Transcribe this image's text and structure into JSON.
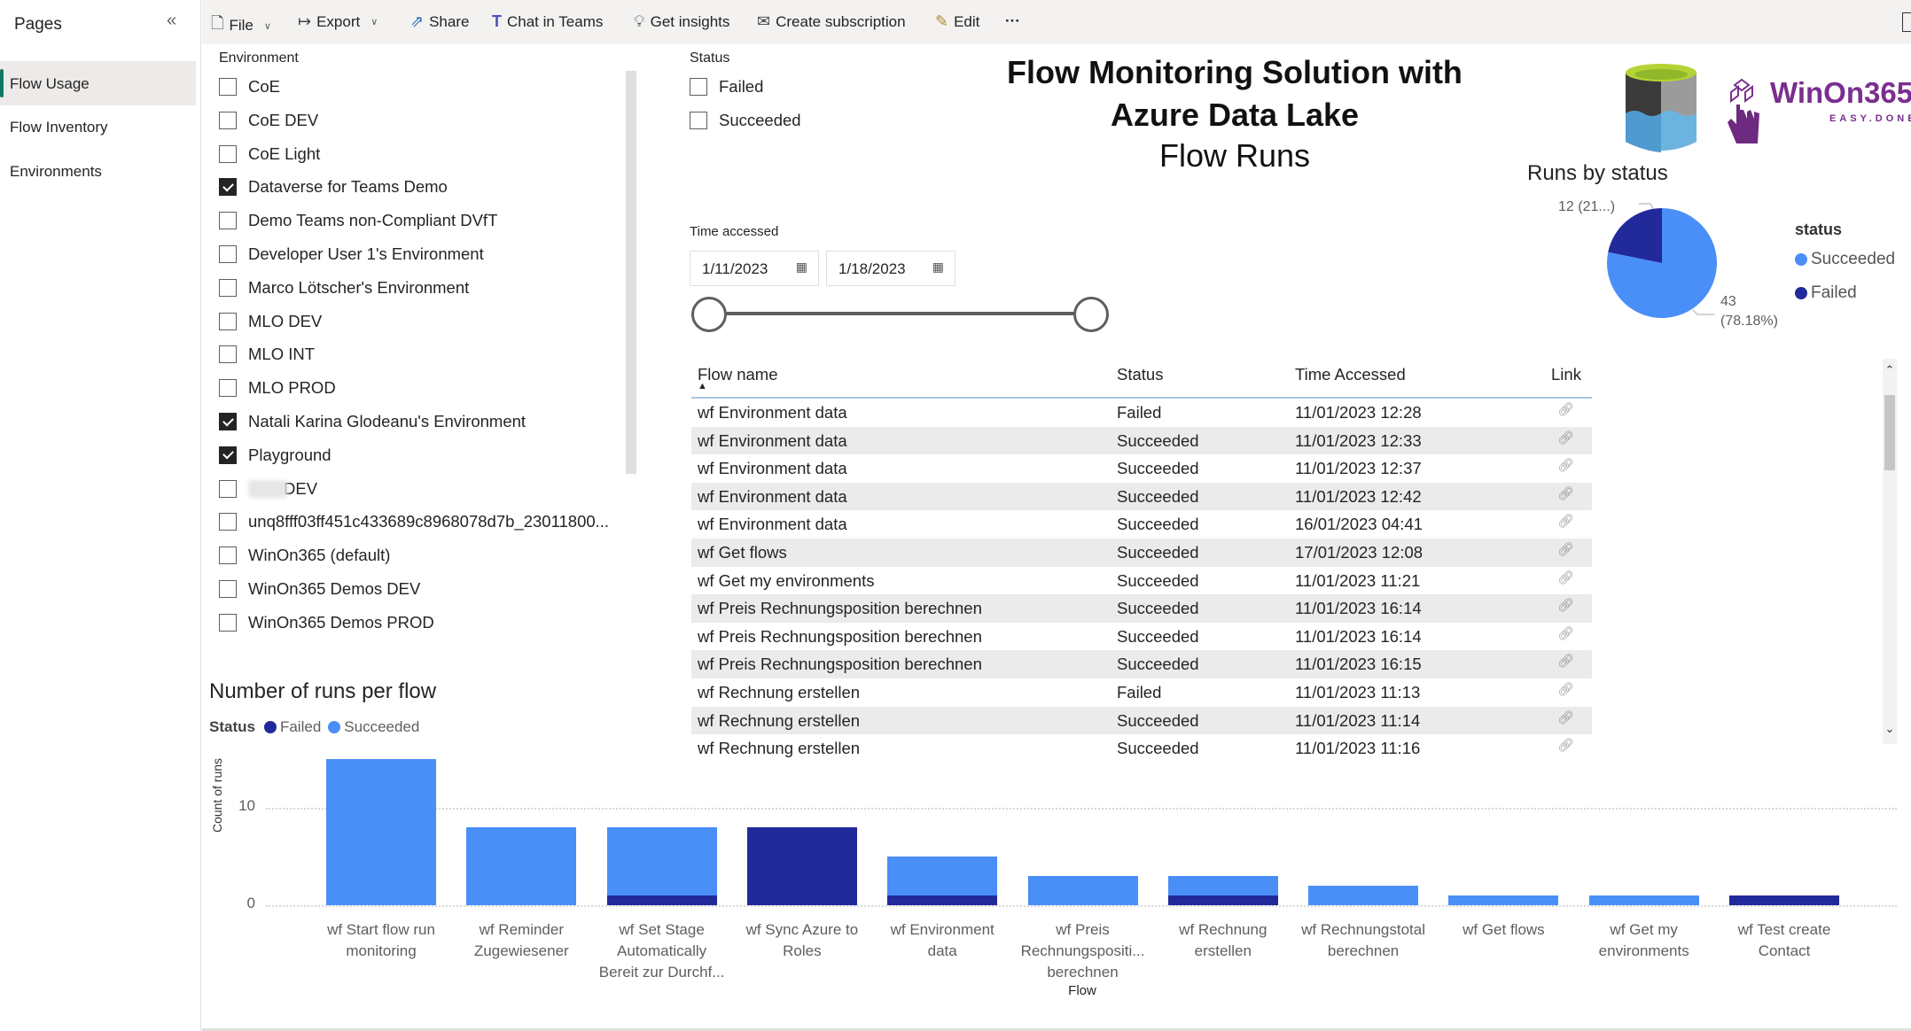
{
  "sidebar": {
    "title": "Pages",
    "collapse_icon": "double-chevron-left",
    "items": [
      {
        "label": "Flow Usage",
        "active": true
      },
      {
        "label": "Flow Inventory",
        "active": false
      },
      {
        "label": "Environments",
        "active": false
      }
    ]
  },
  "toolbar": {
    "items": [
      {
        "label": "File",
        "icon": "file-icon",
        "dropdown": true
      },
      {
        "label": "Export",
        "icon": "export-icon",
        "dropdown": true
      },
      {
        "label": "Share",
        "icon": "share-icon"
      },
      {
        "label": "Chat in Teams",
        "icon": "teams-icon"
      },
      {
        "label": "Get insights",
        "icon": "lightbulb-icon"
      },
      {
        "label": "Create subscription",
        "icon": "subscription-icon"
      },
      {
        "label": "Edit",
        "icon": "pencil-icon"
      }
    ],
    "more_label": "···"
  },
  "environment_slicer": {
    "label": "Environment",
    "items": [
      {
        "label": "CoE",
        "checked": false
      },
      {
        "label": "CoE DEV",
        "checked": false
      },
      {
        "label": "CoE Light",
        "checked": false
      },
      {
        "label": "Dataverse for Teams Demo",
        "checked": true
      },
      {
        "label": "Demo Teams non-Compliant DVfT",
        "checked": false
      },
      {
        "label": "Developer User 1's Environment",
        "checked": false
      },
      {
        "label": "Marco Lötscher's Environment",
        "checked": false
      },
      {
        "label": "MLO DEV",
        "checked": false
      },
      {
        "label": "MLO INT",
        "checked": false
      },
      {
        "label": "MLO PROD",
        "checked": false
      },
      {
        "label": "Natali Karina Glodeanu's Environment",
        "checked": true
      },
      {
        "label": "Playground",
        "checked": true
      },
      {
        "label": "DEV",
        "checked": false,
        "redacted_prefix": true
      },
      {
        "label": "unq8fff03ff451c433689c8968078d7b_23011800...",
        "checked": false
      },
      {
        "label": "WinOn365 (default)",
        "checked": false
      },
      {
        "label": "WinOn365 Demos DEV",
        "checked": false
      },
      {
        "label": "WinOn365 Demos PROD",
        "checked": false
      }
    ]
  },
  "status_slicer": {
    "label": "Status",
    "items": [
      {
        "label": "Failed",
        "checked": false
      },
      {
        "label": "Succeeded",
        "checked": false
      }
    ]
  },
  "header": {
    "title": "Flow Monitoring Solution with Azure Data Lake",
    "subtitle": "Flow Runs",
    "logo_text": "WinOn365",
    "logo_tagline": "EASY.DONE."
  },
  "time_slicer": {
    "label": "Time accessed",
    "start": "1/11/2023",
    "end": "1/18/2023",
    "range_fraction": [
      0,
      1
    ]
  },
  "table": {
    "columns": [
      "Flow name",
      "Status",
      "Time Accessed",
      "Link"
    ],
    "sort": {
      "column": "Flow name",
      "direction": "ascending"
    },
    "rows": [
      {
        "flow": "wf Environment data",
        "status": "Failed",
        "time": "11/01/2023 12:28"
      },
      {
        "flow": "wf Environment data",
        "status": "Succeeded",
        "time": "11/01/2023 12:33"
      },
      {
        "flow": "wf Environment data",
        "status": "Succeeded",
        "time": "11/01/2023 12:37"
      },
      {
        "flow": "wf Environment data",
        "status": "Succeeded",
        "time": "11/01/2023 12:42"
      },
      {
        "flow": "wf Environment data",
        "status": "Succeeded",
        "time": "16/01/2023 04:41"
      },
      {
        "flow": "wf Get flows",
        "status": "Succeeded",
        "time": "17/01/2023 12:08"
      },
      {
        "flow": "wf Get my environments",
        "status": "Succeeded",
        "time": "11/01/2023 11:21"
      },
      {
        "flow": "wf Preis Rechnungsposition berechnen",
        "status": "Succeeded",
        "time": "11/01/2023 16:14"
      },
      {
        "flow": "wf Preis Rechnungsposition berechnen",
        "status": "Succeeded",
        "time": "11/01/2023 16:14"
      },
      {
        "flow": "wf Preis Rechnungsposition berechnen",
        "status": "Succeeded",
        "time": "11/01/2023 16:15"
      },
      {
        "flow": "wf Rechnung erstellen",
        "status": "Failed",
        "time": "11/01/2023 11:13"
      },
      {
        "flow": "wf Rechnung erstellen",
        "status": "Succeeded",
        "time": "11/01/2023 11:14"
      },
      {
        "flow": "wf Rechnung erstellen",
        "status": "Succeeded",
        "time": "11/01/2023 11:16"
      }
    ]
  },
  "colors": {
    "succeeded": "#4a8ef8",
    "failed": "#22299a",
    "active_page_accent": "#117865"
  },
  "chart_data": [
    {
      "type": "pie",
      "title": "Runs by status",
      "legend_title": "status",
      "legend_position": "right",
      "slices": [
        {
          "name": "Succeeded",
          "value": 43,
          "label": "43 (78.18%)"
        },
        {
          "name": "Failed",
          "value": 12,
          "label": "12 (21...)"
        }
      ]
    },
    {
      "type": "bar",
      "stacked": true,
      "title": "Number of runs per flow",
      "legend_title": "Status",
      "legend_position": "top-left",
      "xlabel": "Flow",
      "ylabel": "Count of runs",
      "ylim": [
        0,
        15
      ],
      "yticks": [
        0,
        10
      ],
      "grid": true,
      "categories": [
        [
          "wf Start flow run",
          "monitoring"
        ],
        [
          "wf Reminder",
          "Zugewiesener"
        ],
        [
          "wf Set Stage",
          "Automatically",
          "Bereit zur Durchf..."
        ],
        [
          "wf Sync Azure to",
          "Roles"
        ],
        [
          "wf Environment",
          "data"
        ],
        [
          "wf Preis",
          "Rechnungspositi...",
          "berechnen"
        ],
        [
          "wf Rechnung",
          "erstellen"
        ],
        [
          "wf Rechnungstotal",
          "berechnen"
        ],
        [
          "wf Get flows"
        ],
        [
          "wf Get my",
          "environments"
        ],
        [
          "wf Test create",
          "Contact"
        ]
      ],
      "series": [
        {
          "name": "Failed",
          "values": [
            0,
            0,
            1,
            8,
            1,
            0,
            1,
            0,
            0,
            0,
            1
          ]
        },
        {
          "name": "Succeeded",
          "values": [
            15,
            8,
            7,
            0,
            4,
            3,
            2,
            2,
            1,
            1,
            0
          ]
        }
      ]
    }
  ]
}
